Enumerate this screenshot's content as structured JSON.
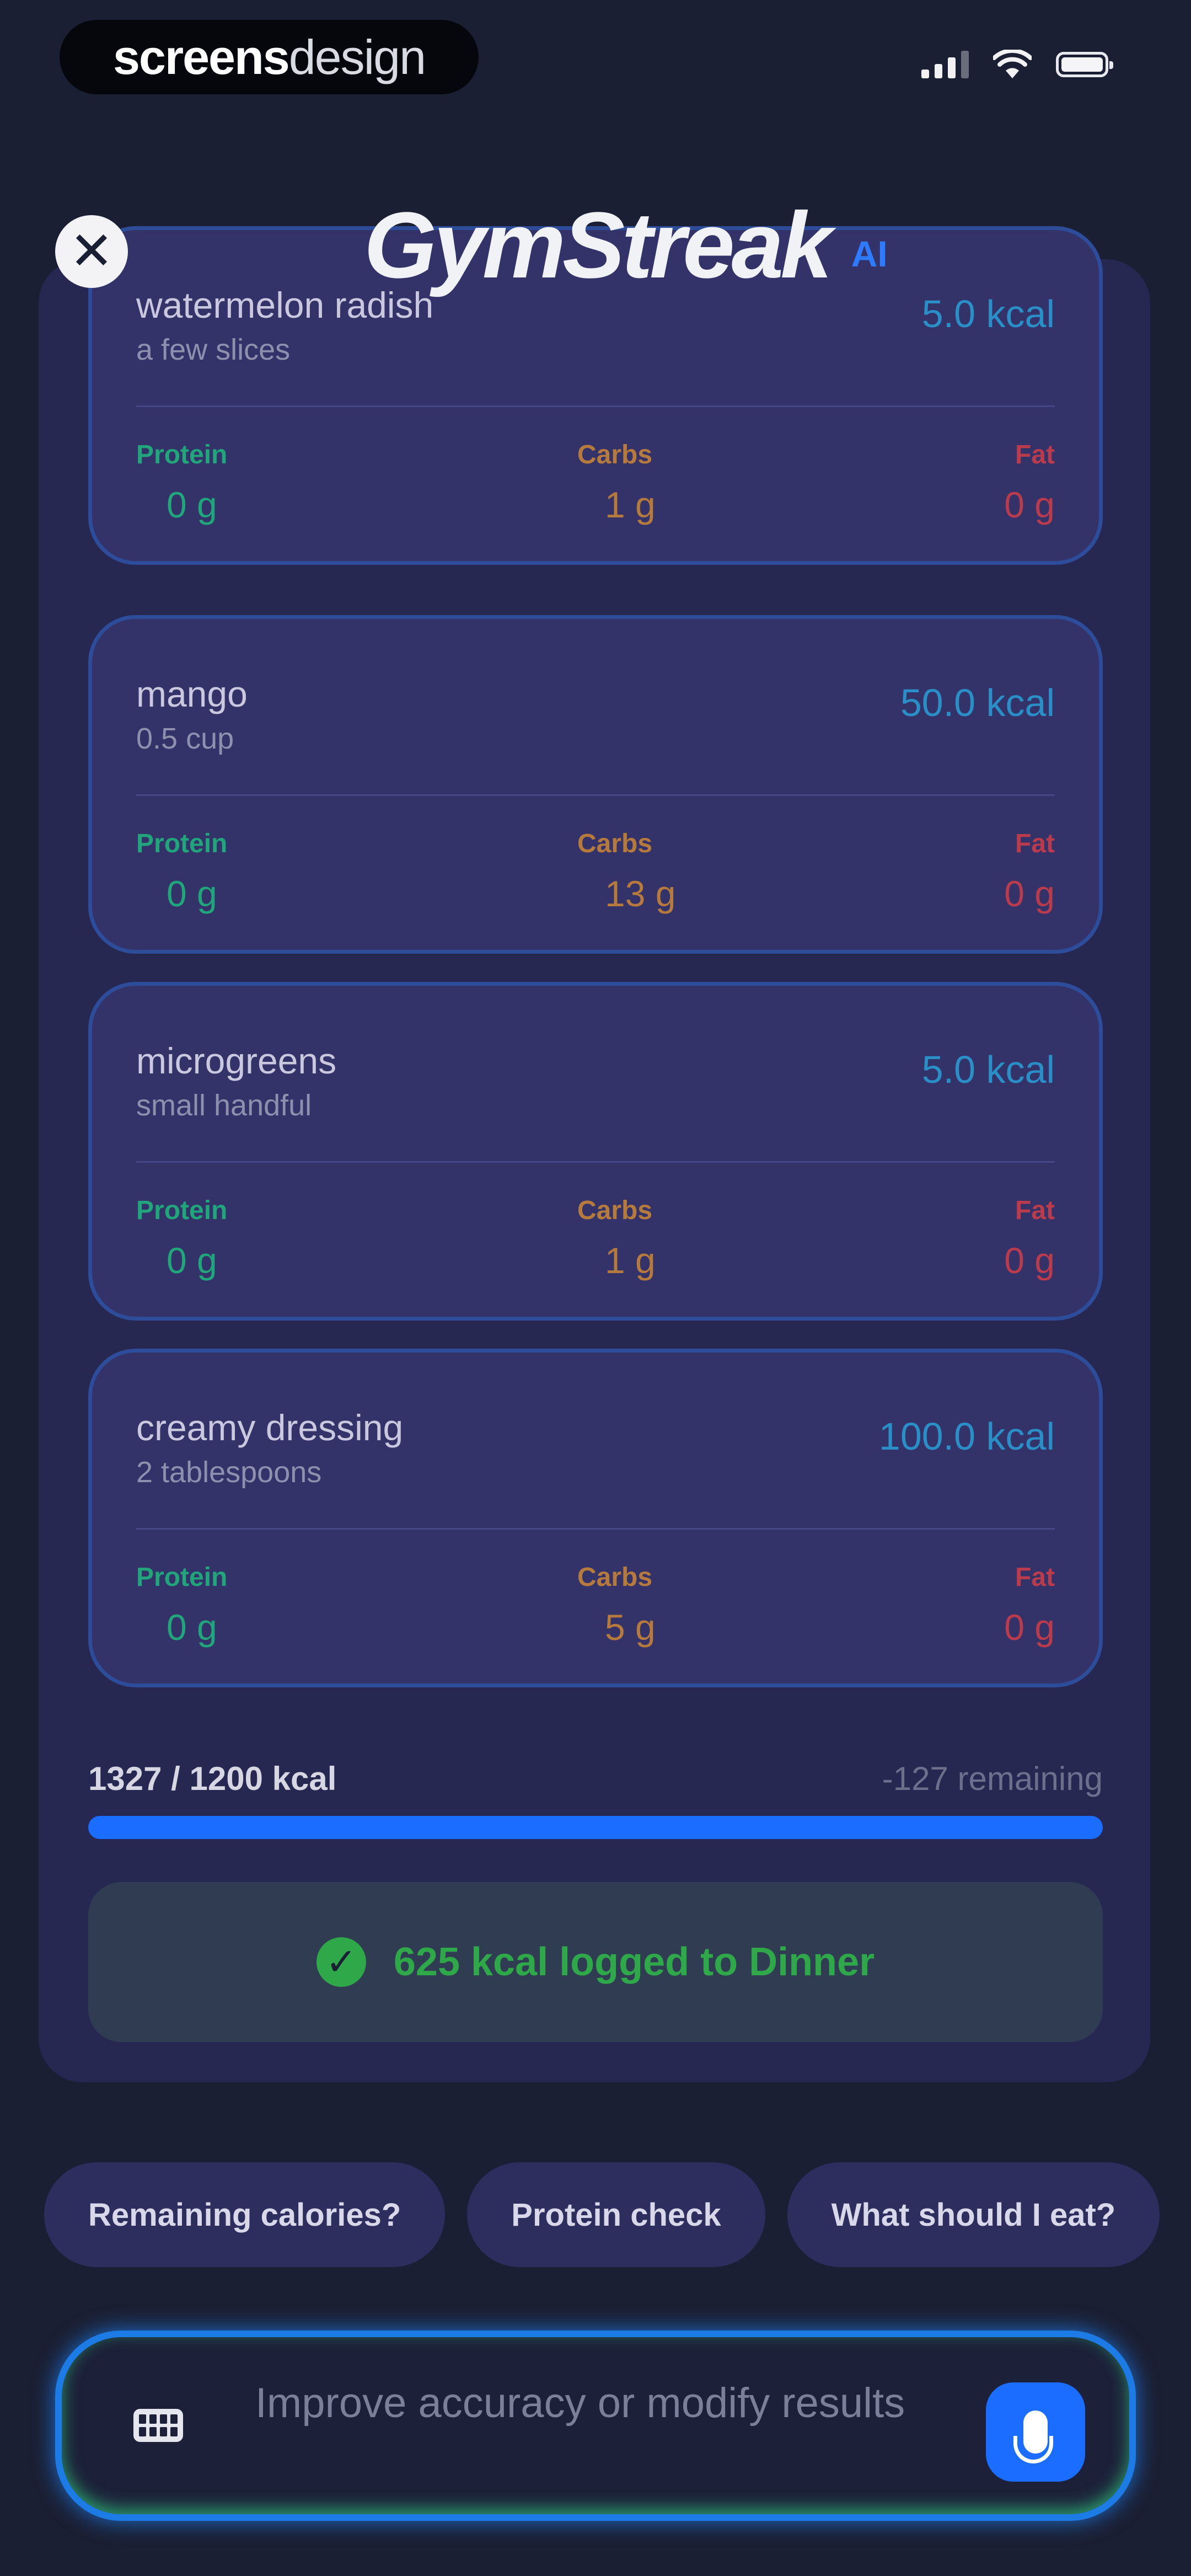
{
  "watermark": {
    "bold": "screens",
    "regular": "design"
  },
  "header": {
    "logo": "GymStreak",
    "badge": "AI",
    "close_glyph": "✕"
  },
  "foods": [
    {
      "name": "watermelon radish",
      "portion": "a few slices",
      "kcal": "5.0 kcal",
      "protein": "0 g",
      "carbs": "1 g",
      "fat": "0 g"
    },
    {
      "name": "mango",
      "portion": "0.5 cup",
      "kcal": "50.0 kcal",
      "protein": "0 g",
      "carbs": "13 g",
      "fat": "0 g"
    },
    {
      "name": "microgreens",
      "portion": "small handful",
      "kcal": "5.0 kcal",
      "protein": "0 g",
      "carbs": "1 g",
      "fat": "0 g"
    },
    {
      "name": "creamy dressing",
      "portion": "2 tablespoons",
      "kcal": "100.0 kcal",
      "protein": "0 g",
      "carbs": "5 g",
      "fat": "0 g"
    }
  ],
  "macro_labels": {
    "protein": "Protein",
    "carbs": "Carbs",
    "fat": "Fat"
  },
  "summary": {
    "total": "1327 / 1200 kcal",
    "remaining": "-127 remaining",
    "progress_fraction": 1.0,
    "logged": "625 kcal logged to Dinner"
  },
  "chips": [
    "Remaining calories?",
    "Protein check",
    "What should I eat?"
  ],
  "input": {
    "placeholder": "Improve accuracy or modify results"
  },
  "colors": {
    "accent": "#1a6dff",
    "protein": "#20a67a",
    "carbs": "#b67a3c",
    "fat": "#b93b4c",
    "success": "#2fa84a"
  }
}
